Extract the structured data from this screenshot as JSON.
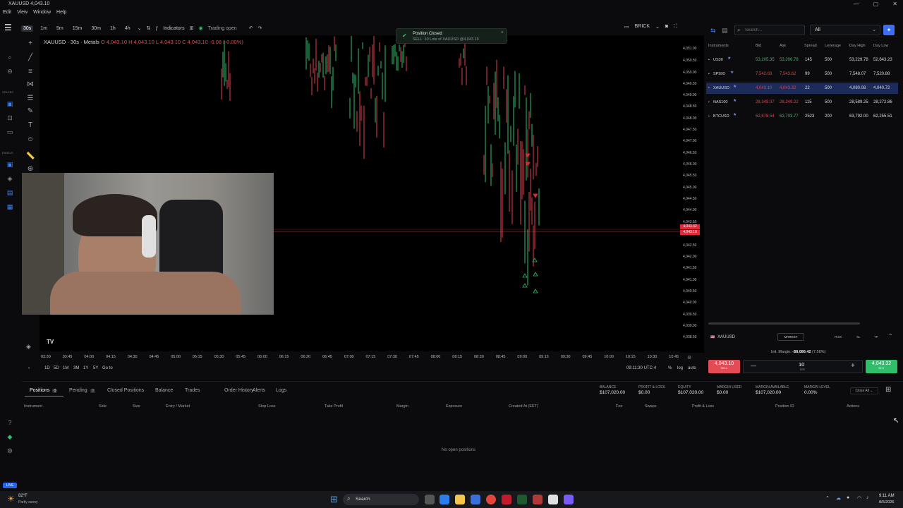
{
  "window": {
    "title": "XAUUSD 4,043.10",
    "controls": [
      "—",
      "▢",
      "✕"
    ]
  },
  "menu": [
    "Edit",
    "View",
    "Window",
    "Help"
  ],
  "toolbar": {
    "timeframes": [
      "30s",
      "1m",
      "5m",
      "15m",
      "30m",
      "1h",
      "4h"
    ],
    "active_timeframe": "30s",
    "indicators_label": "Indicators",
    "trading_status": "Trading open",
    "chart_style": "BRICK"
  },
  "leftnav": {
    "spaces_label": "SPACES",
    "panels_label": "PANELS"
  },
  "symbol": {
    "name": "XAUUSD · 30s · Metals",
    "o": "O 4,043.10",
    "h": "H 4,043.10",
    "l": "L 4,043.10",
    "c": "C 4,043.10",
    "chg": "-0.08 (-0.00%)"
  },
  "toast": {
    "title": "Position Closed",
    "body": "SELL: 10 Lots of XAUUSD @4,043.19"
  },
  "yaxis": [
    "4,051.00",
    "4,050.50",
    "4,050.00",
    "4,049.50",
    "4,049.00",
    "4,048.50",
    "4,048.00",
    "4,047.50",
    "4,047.00",
    "4,046.50",
    "4,046.00",
    "4,045.50",
    "4,045.00",
    "4,044.50",
    "4,044.00",
    "4,043.50",
    "4,042.50",
    "4,042.00",
    "4,041.50",
    "4,041.00",
    "4,040.50",
    "4,040.00",
    "4,039.50",
    "4,039.00",
    "4,038.50"
  ],
  "price_badges": [
    "4,043.32",
    "4,043.10"
  ],
  "xaxis": [
    "03:30",
    "03:45",
    "04:00",
    "04:15",
    "04:30",
    "04:45",
    "05:00",
    "05:15",
    "05:30",
    "05:45",
    "06:00",
    "06:15",
    "06:30",
    "06:45",
    "07:00",
    "07:15",
    "07:30",
    "07:45",
    "08:00",
    "08:15",
    "08:30",
    "08:45",
    "09:00",
    "09:15",
    "09:30",
    "09:45",
    "10:00",
    "10:15",
    "10:30",
    "10:45"
  ],
  "chart_bottom": {
    "ranges": [
      "1D",
      "5D",
      "1M",
      "3M",
      "1Y",
      "5Y"
    ],
    "goto": "Go to",
    "time": "09:11:30 UTC-4",
    "pct": "%",
    "log": "log",
    "auto": "auto"
  },
  "watchlist": {
    "search_placeholder": "Search...",
    "filter": "All",
    "headers": [
      "Instruments",
      "Bid",
      "Ask",
      "Spread",
      "Leverage",
      "Day High",
      "Day Low"
    ],
    "rows": [
      {
        "sym": "US30",
        "bid": "53,205.35",
        "ask": "53,206.78",
        "spread": "145",
        "lev": "500",
        "high": "53,229.78",
        "low": "52,643.23",
        "bidc": "green",
        "askc": "green",
        "sel": false
      },
      {
        "sym": "SP500",
        "bid": "7,542.63",
        "ask": "7,543.62",
        "spread": "99",
        "lev": "500",
        "high": "7,548.07",
        "low": "7,520.88",
        "bidc": "red",
        "askc": "red",
        "sel": false
      },
      {
        "sym": "XAUUSD",
        "bid": "4,043.10",
        "ask": "4,043.32",
        "spread": "22",
        "lev": "500",
        "high": "4,080.08",
        "low": "4,040.72",
        "bidc": "red",
        "askc": "red",
        "sel": true
      },
      {
        "sym": "NAS100",
        "bid": "28,348.07",
        "ask": "28,349.22",
        "spread": "115",
        "lev": "500",
        "high": "28,589.25",
        "low": "28,272.86",
        "bidc": "red",
        "askc": "red",
        "sel": false
      },
      {
        "sym": "BTCUSD",
        "bid": "62,678.54",
        "ask": "62,703.77",
        "spread": "2523",
        "lev": "200",
        "high": "63,792.00",
        "low": "62,255.51",
        "bidc": "red",
        "askc": "green",
        "sel": false
      }
    ]
  },
  "trade": {
    "symbol": "XAUUSD",
    "order_type": "MARKET",
    "tabs": [
      "RISK",
      "SL",
      "TP"
    ],
    "margin_label": "Init. Margin:",
    "margin_value": "-$8,086.42",
    "margin_pct": "(7.56%)",
    "sell_price": "4,043.10",
    "sell_label": "SELL",
    "buy_price": "4,043.32",
    "buy_label": "BUY",
    "lots": "10",
    "lots_label": "lots",
    "minus": "—",
    "plus": "+"
  },
  "positions": {
    "tabs": [
      {
        "label": "Positions",
        "count": "0"
      },
      {
        "label": "Pending",
        "count": "0"
      },
      {
        "label": "Closed Positions"
      },
      {
        "label": "Balance"
      },
      {
        "label": "Trades"
      },
      {
        "label": "Order History"
      },
      {
        "label": "Alerts"
      },
      {
        "label": "Logs"
      }
    ],
    "account": [
      {
        "label": "BALANCE",
        "value": "$107,020.00"
      },
      {
        "label": "PROFIT & LOSS",
        "value": "$0.00"
      },
      {
        "label": "EQUITY",
        "value": "$107,020.00"
      },
      {
        "label": "MARGIN USED",
        "value": "$0.00"
      },
      {
        "label": "MARGIN AVAILABLE",
        "value": "$107,020.00"
      },
      {
        "label": "MARGIN LEVEL",
        "value": "0.00%"
      }
    ],
    "close_all": "Close All",
    "columns": [
      "Instrument",
      "Side",
      "Size",
      "Entry / Market",
      "Stop Loss",
      "Take Profit",
      "Margin",
      "Exposure",
      "Created At (EET)",
      "Fee",
      "Swaps",
      "Profit & Loss",
      "Position ID",
      "Actions"
    ],
    "empty": "No open positions"
  },
  "live_badge": "LIVE",
  "taskbar": {
    "weather_temp": "82°F",
    "weather_desc": "Partly sunny",
    "search": "Search",
    "time": "9:11 AM",
    "date": "8/5/2026"
  }
}
